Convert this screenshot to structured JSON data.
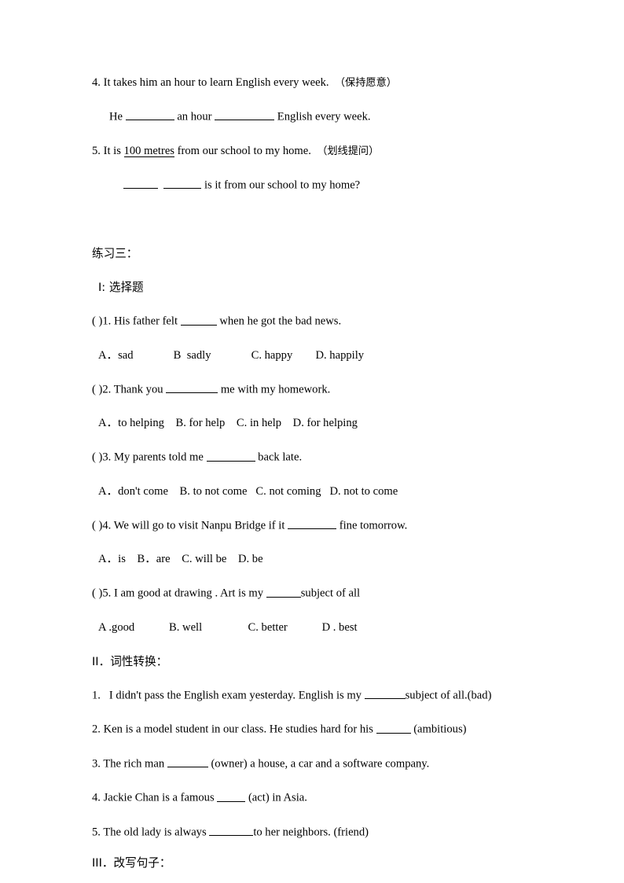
{
  "document": {
    "type": "worksheet",
    "language": "en-zh"
  },
  "sentence_transform": {
    "items": [
      {
        "number": "4.",
        "prompt_before": " It takes him an hour to learn English every week.",
        "instruction": "（保持愿意）",
        "answer_line": {
          "prefix": "He ",
          "blank1_width": 62,
          "middle": " an hour ",
          "blank2_width": 76,
          "suffix": " English every week."
        }
      },
      {
        "number": "5.",
        "prompt_before": " It is ",
        "underlined_phrase": "100 metres",
        "prompt_after": " from our school to my home.",
        "instruction": "（划线提问）",
        "answer_line": {
          "blank1_width": 44,
          "gap": "  ",
          "blank2_width": 48,
          "suffix": " is it from our school to my home?"
        }
      }
    ]
  },
  "exercise": {
    "title": "练习三：",
    "sections": [
      {
        "id": "section-1",
        "label": "I: 选择题",
        "roman": "I",
        "questions": [
          {
            "marker": "( )",
            "number": "1.",
            "text_before": " His father felt ",
            "blank_width": 46,
            "text_after": " when he got the bad news.",
            "options_raw": "A．sad              B  sadly              C. happy        D. happily"
          },
          {
            "marker": "( )",
            "number": "2.",
            "text_before": " Thank you ",
            "blank_width": 66,
            "text_after": " me with my homework.",
            "options_raw": "A．to helping    B. for help    C. in help    D. for helping"
          },
          {
            "marker": "( )",
            "number": "3.",
            "text_before": " My parents told me ",
            "blank_width": 62,
            "text_after": " back late.",
            "options_raw": "A．don't come    B. to not come   C. not coming   D. not to come"
          },
          {
            "marker": "( )",
            "number": "4.",
            "text_before": " We will go to visit Nanpu Bridge if it ",
            "blank_width": 62,
            "text_after": " fine tomorrow.",
            "options_raw": "A．is    B．are    C. will be    D. be"
          },
          {
            "marker": "( )",
            "number": "5.",
            "text_before": " I am good at drawing . Art is my ",
            "blank_width": 44,
            "text_after": "subject of all",
            "options_raw": "A .good            B. well                C. better            D . best"
          }
        ]
      },
      {
        "id": "section-2",
        "label": "II．词性转换：",
        "roman": "II",
        "items": [
          {
            "number": "1.",
            "text_before": "   I didn't pass the English exam yesterday. English is my ",
            "blank_width": 52,
            "text_after": "subject of all.(bad)"
          },
          {
            "number": "2.",
            "text_before": " Ken is a model student in our class. He studies hard for his ",
            "blank_width": 44,
            "text_after": " (ambitious)"
          },
          {
            "number": "3.",
            "text_before": " The rich man ",
            "blank_width": 52,
            "text_after": " (owner) a house, a car and a software company."
          },
          {
            "number": "4.",
            "text_before": " Jackie Chan is a famous ",
            "blank_width": 36,
            "text_after": " (act) in Asia."
          },
          {
            "number": "5.",
            "text_before": " The old lady is always ",
            "blank_width": 56,
            "text_after": "to her neighbors. (friend)"
          }
        ]
      },
      {
        "id": "section-3",
        "label": "III．改写句子：",
        "roman": "III",
        "items": []
      }
    ]
  }
}
